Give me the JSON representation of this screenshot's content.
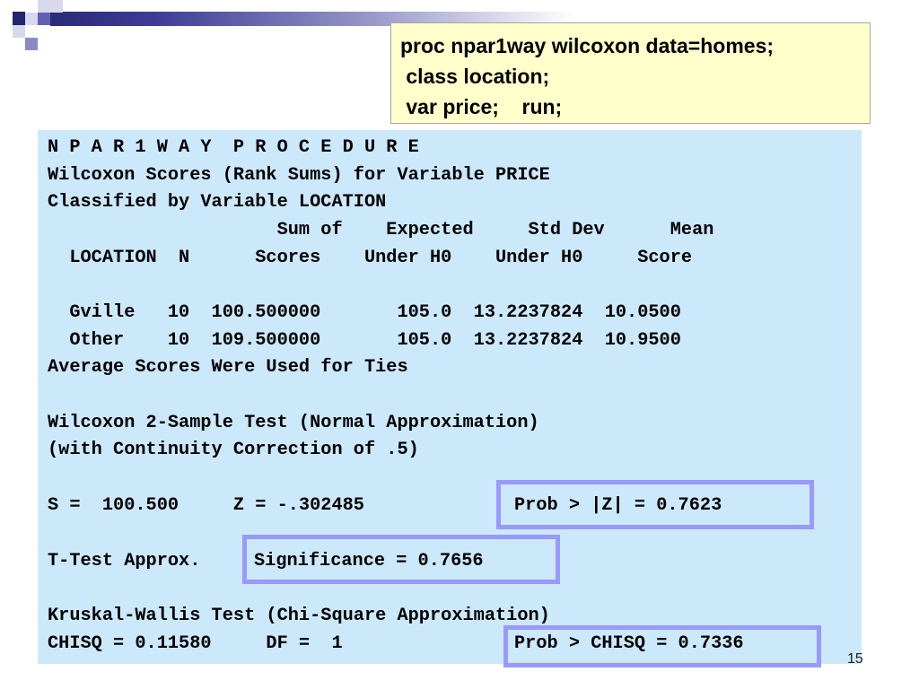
{
  "code": {
    "lines": [
      "proc npar1way wilcoxon data=homes;",
      " class location;",
      " var price;    run;"
    ]
  },
  "output": {
    "title": "N P A R 1 W A Y  P R O C E D U R E",
    "subtitle": "Wilcoxon Scores (Rank Sums) for Variable PRICE",
    "classified_by": "Classified by Variable LOCATION",
    "header1": "                     Sum of    Expected     Std Dev      Mean",
    "header2": "  LOCATION  N      Scores    Under H0    Under H0     Score",
    "rows": [
      "  Gville   10  100.500000       105.0  13.2237824  10.0500",
      "  Other    10  109.500000       105.0  13.2237824  10.9500"
    ],
    "ties_note": "Average Scores Were Used for Ties",
    "wilcoxon_test": "Wilcoxon 2-Sample Test (Normal Approximation)",
    "continuity": "(with Continuity Correction of .5)",
    "s_z_line": "S =  100.500     Z = -.302485",
    "prob_z": "Prob > |Z| = 0.7623",
    "ttest_label": "T-Test Approx.",
    "significance": "Significance = 0.7656",
    "kruskal": "Kruskal-Wallis Test (Chi-Square Approximation)",
    "chisq_line": "CHISQ = 0.11580     DF =  1",
    "prob_chisq": "Prob > CHISQ = 0.7336"
  },
  "slide": {
    "page_number": "15"
  },
  "colors": {
    "code_bg": "#ffffcc",
    "panel_bg": "#cce9fc",
    "highlight_border": "#9999ff",
    "banner_dark": "#24246f"
  }
}
